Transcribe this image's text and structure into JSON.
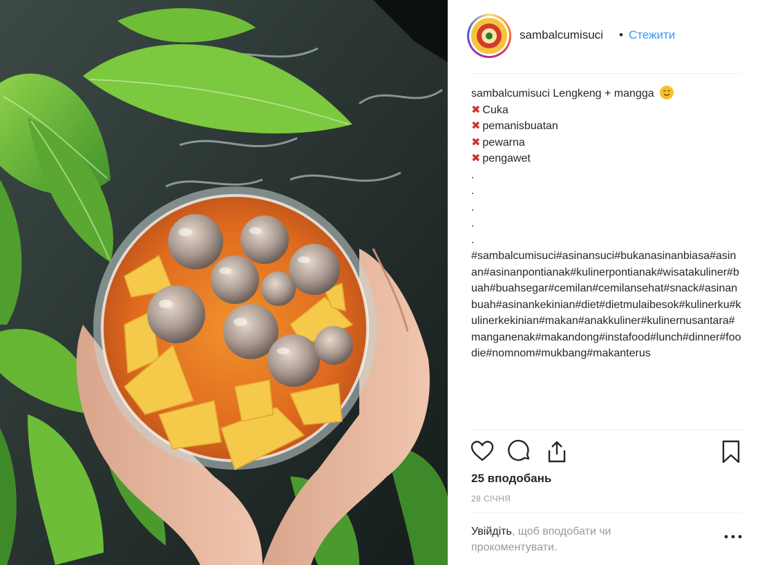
{
  "header": {
    "username": "sambalcumisuci",
    "separator": "•",
    "follow_label": "Стежити"
  },
  "caption": {
    "username": "sambalcumisuci",
    "title": "Lengkeng + mangga",
    "title_emoji": "smiling-face-emoji",
    "excluded_items": [
      "Cuka",
      "pemanisbuatan",
      "pewarna",
      "pengawet"
    ],
    "excluded_marker": "cross-mark-icon",
    "dots": [
      ".",
      ".",
      ".",
      ".",
      "."
    ],
    "hashtags": "#sambalcumisuci#asinansuci#bukanasinanbiasa#asinan#asinanpontianak#kulinerpontianak#wisatakuliner#buah#buahsegar#cemilan#cemilansehat#snack#asinanbuah#asinankekinian#diet#dietmulaibesok#kulinerku#kulinerkekinian#makan#anakkuliner#kulinernusantara#manganenak#makandong#instafood#lunch#dinner#foodie#nomnom#mukbang#makanterus"
  },
  "actions": {
    "icons": [
      "heart-icon",
      "comment-icon",
      "share-icon",
      "bookmark-icon"
    ]
  },
  "likes_text": "25 вподобань",
  "date_text": "28 СІЧНЯ",
  "login_prompt": {
    "link_label": "Увійдіть",
    "rest": ", щоб вподобати чи прокоментувати."
  },
  "colors": {
    "link_blue": "#3897f0",
    "text": "#262626",
    "muted": "#999999",
    "divider": "#efefef",
    "cross_red": "#d0312d"
  }
}
